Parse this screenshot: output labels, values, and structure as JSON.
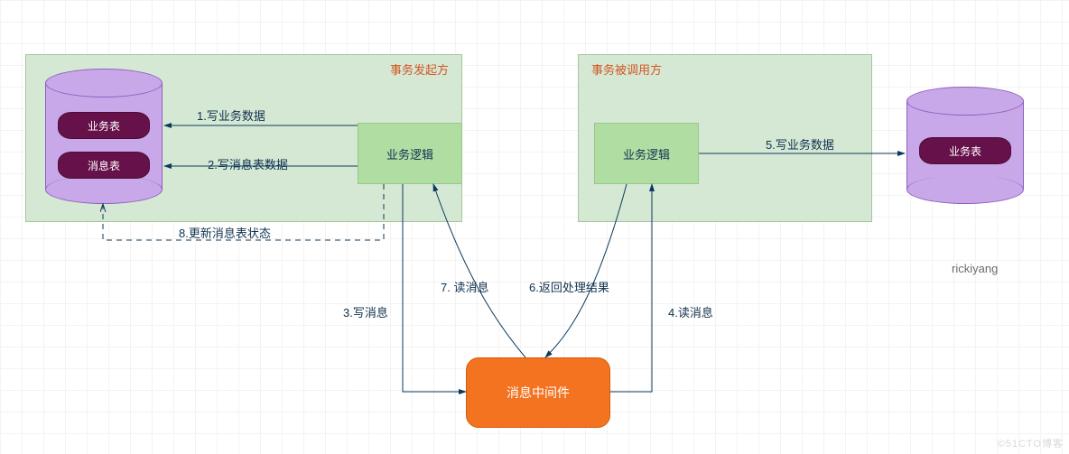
{
  "panels": {
    "left": {
      "title": "事务发起方"
    },
    "right": {
      "title": "事务被调用方"
    }
  },
  "nodes": {
    "leftLogic": "业务逻辑",
    "rightLogic": "业务逻辑",
    "mq": "消息中间件"
  },
  "db": {
    "left": {
      "tables": [
        "业务表",
        "消息表"
      ]
    },
    "right": {
      "tables": [
        "业务表"
      ]
    }
  },
  "edges": {
    "e1": "1.写业务数据",
    "e2": "2.写消息表数据",
    "e3": "3.写消息",
    "e4": "4.读消息",
    "e5": "5.写业务数据",
    "e6": "6.返回处理结果",
    "e7": "7. 读消息",
    "e8": "8.更新消息表状态"
  },
  "credit": "rickiyang",
  "watermark": "©51CTO博客"
}
